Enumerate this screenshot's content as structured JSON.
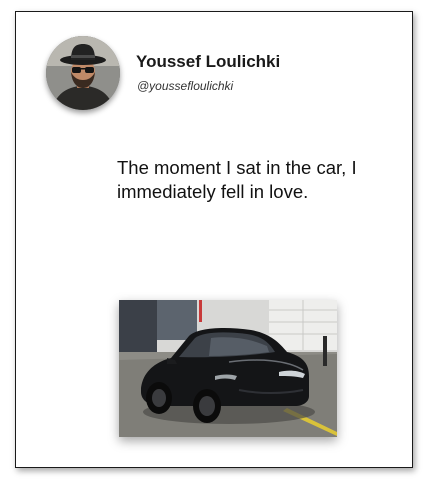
{
  "post": {
    "author": {
      "name": "Youssef Loulichki",
      "handle": "@youssefloulichki",
      "avatar_icon": "person-with-hat-and-sunglasses-avatar"
    },
    "text": "The moment I sat in the car, I immediately fell in love.",
    "image": {
      "icon": "black-car-photo"
    }
  }
}
